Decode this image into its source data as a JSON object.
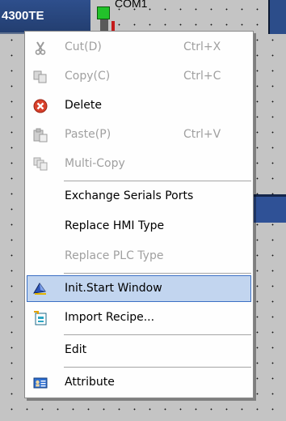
{
  "canvas": {
    "node_title": "4300TE",
    "com_label": "COM1"
  },
  "menu": {
    "items": [
      {
        "label": "Cut(D)",
        "shortcut": "Ctrl+X",
        "icon": "scissors-icon",
        "enabled": false
      },
      {
        "label": "Copy(C)",
        "shortcut": "Ctrl+C",
        "icon": "copy-icon",
        "enabled": false
      },
      {
        "label": "Delete",
        "shortcut": "",
        "icon": "delete-icon",
        "enabled": true
      },
      {
        "label": "Paste(P)",
        "shortcut": "Ctrl+V",
        "icon": "paste-icon",
        "enabled": false
      },
      {
        "label": "Multi-Copy",
        "shortcut": "",
        "icon": "multi-copy-icon",
        "enabled": false
      },
      {
        "label": "Exchange Serials Ports",
        "shortcut": "",
        "icon": "",
        "enabled": true
      },
      {
        "label": "Replace HMI Type",
        "shortcut": "",
        "icon": "",
        "enabled": true
      },
      {
        "label": "Replace PLC Type",
        "shortcut": "",
        "icon": "",
        "enabled": false
      },
      {
        "label": "Init.Start Window",
        "shortcut": "",
        "icon": "window-icon",
        "enabled": true,
        "highlighted": true
      },
      {
        "label": "Import Recipe...",
        "shortcut": "",
        "icon": "import-recipe-icon",
        "enabled": true
      },
      {
        "label": "Edit",
        "shortcut": "",
        "icon": "",
        "enabled": true
      },
      {
        "label": "Attribute",
        "shortcut": "",
        "icon": "attribute-icon",
        "enabled": true
      }
    ]
  },
  "colors": {
    "highlight_bg": "#c2d5ef",
    "highlight_border": "#3b6fc4",
    "node_blue": "#2e4f8c",
    "port_green": "#22c22a",
    "delete_red": "#d9412b"
  }
}
